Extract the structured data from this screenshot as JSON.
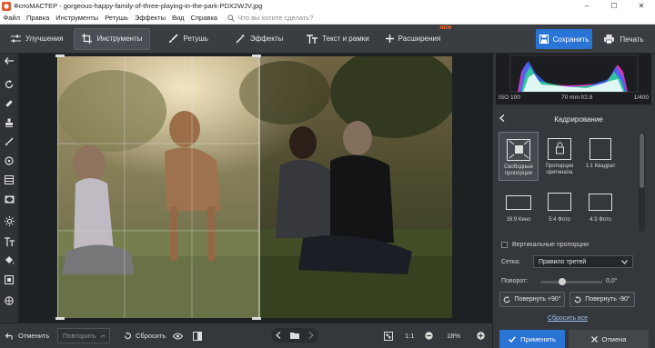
{
  "window": {
    "title": "ФотоМАСТЕР - gorgeous-happy-family-of-three-playing-in-the-park-PDX2WJV.jpg",
    "controls": [
      "–",
      "☐",
      "✕"
    ]
  },
  "menu": {
    "items": [
      "Файл",
      "Правка",
      "Инструменты",
      "Ретушь",
      "Эффекты",
      "Вид",
      "Справка"
    ],
    "search_placeholder": "Что вы хотите сделать?"
  },
  "toolbar": {
    "tabs": [
      {
        "label": "Улучшения",
        "icon": "sliders-icon"
      },
      {
        "label": "Инструменты",
        "icon": "crop-icon",
        "active": true
      },
      {
        "label": "Ретушь",
        "icon": "brush-icon"
      },
      {
        "label": "Эффекты",
        "icon": "magic-wand-icon"
      },
      {
        "label": "Текст и рамки",
        "icon": "text-icon"
      },
      {
        "label": "Расширения",
        "icon": "plus-icon",
        "badge": "NEW"
      }
    ],
    "save_label": "Сохранить",
    "print_label": "Печать"
  },
  "histogram": {
    "iso": "ISO 100",
    "lens": "70 mm f/2.8",
    "shutter": "1/400"
  },
  "panel": {
    "title": "Кадрирование",
    "presets": [
      {
        "label": "Свободные пропорции",
        "selected": true
      },
      {
        "label": "Пропорции оригинала",
        "selected": false
      },
      {
        "label": "1:1 Квадрат",
        "selected": false
      },
      {
        "label": "16:9 Кино",
        "selected": false
      },
      {
        "label": "5:4 Фото",
        "selected": false
      },
      {
        "label": "4:3 Фото",
        "selected": false
      }
    ],
    "vertical_label": "Вертикальные пропорции",
    "grid_label": "Сетка:",
    "grid_value": "Правило третей",
    "rotate_label": "Поворот:",
    "rotate_value": "0,0°",
    "rotate_plus": "Повернуть +90°",
    "rotate_minus": "Повернуть -90°",
    "reset_label": "Сбросить все",
    "apply_label": "Применить",
    "cancel_label": "Отмена"
  },
  "bottombar": {
    "undo_label": "Отменить",
    "redo_label": "Повторить",
    "reset_label": "Сбросить",
    "ratio_label": "1:1",
    "zoom_value": "18%"
  },
  "colors": {
    "accent": "#2a74d6",
    "toolbar_bg": "#3a3d41",
    "panel_bg": "#34373b",
    "badge": "#ff6a2a"
  }
}
